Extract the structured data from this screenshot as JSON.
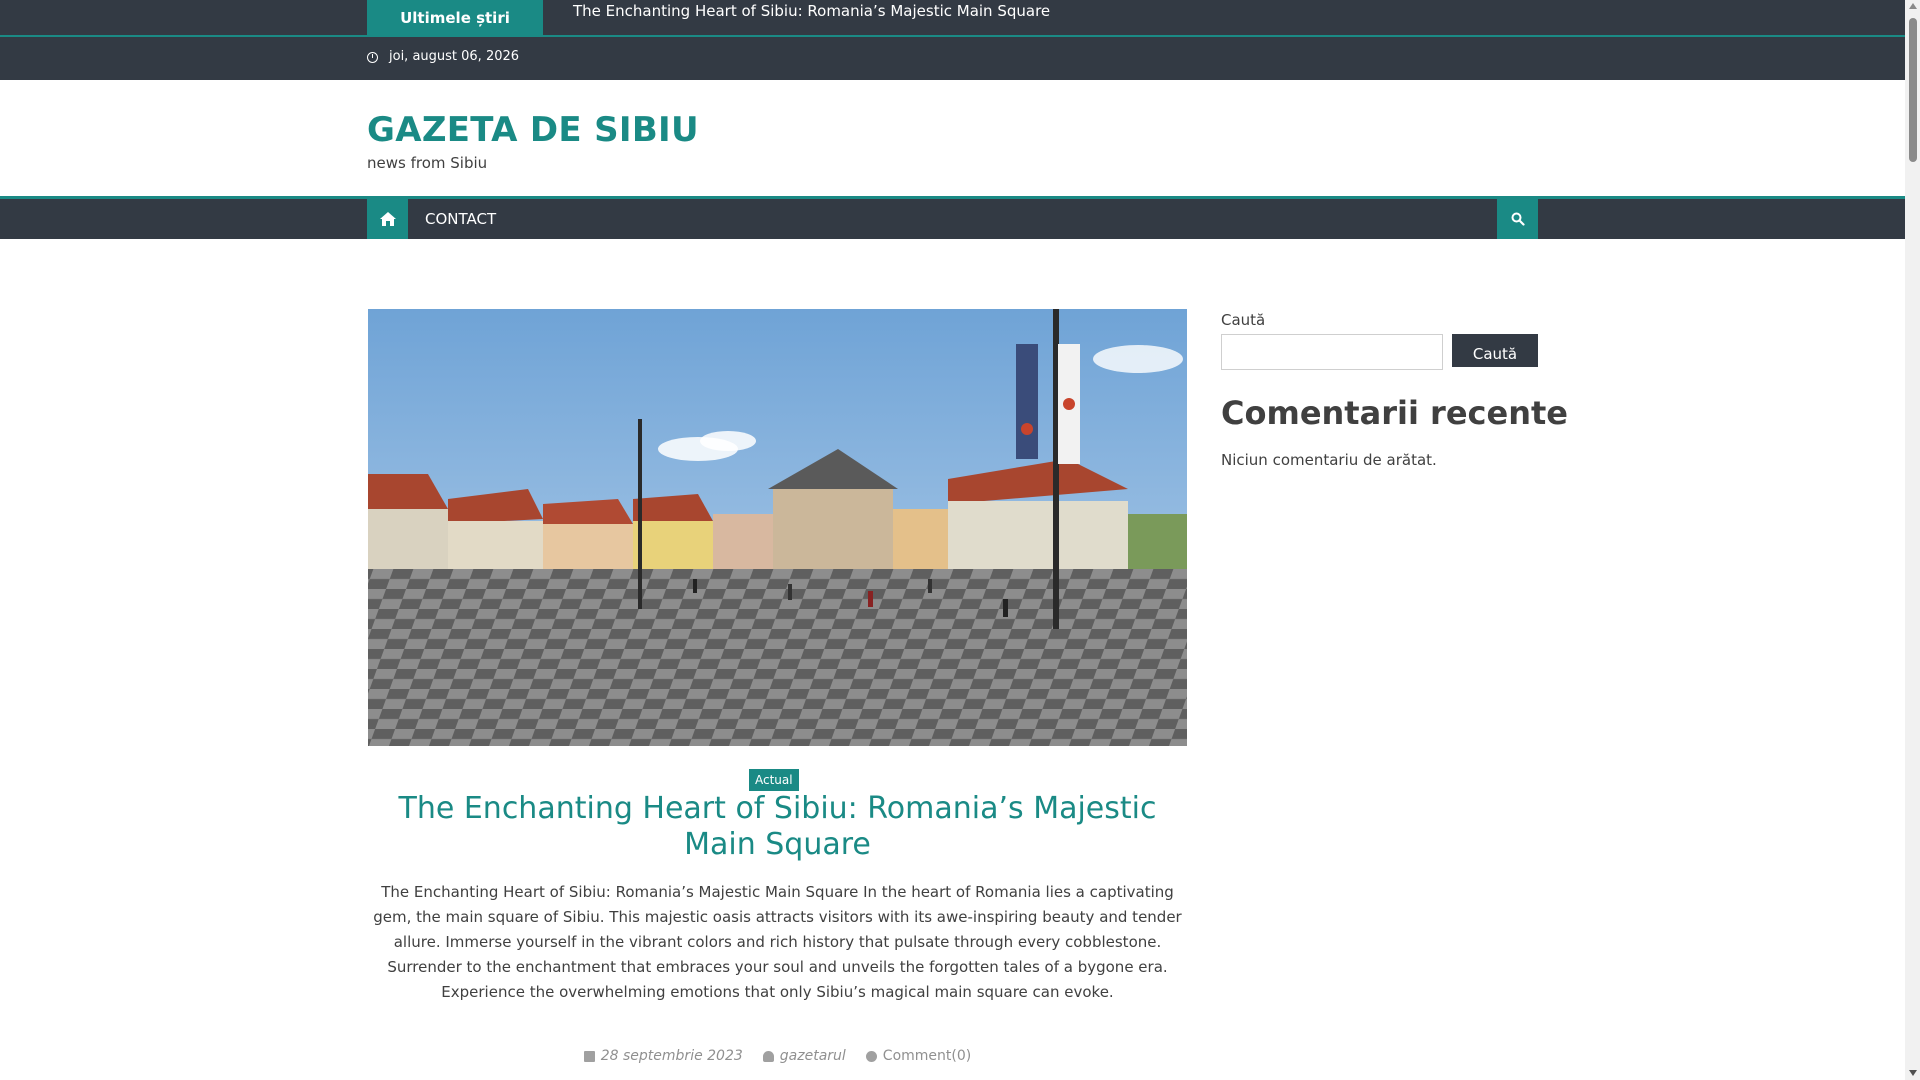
{
  "ticker": {
    "label": "Ultimele știri",
    "headline": "The Enchanting Heart of Sibiu: Romania’s Majestic Main Square"
  },
  "datebar": {
    "date": "joi, august 06, 2026",
    "icon": "clock-icon"
  },
  "site": {
    "title": "GAZETA DE SIBIU",
    "tagline": "news from Sibiu"
  },
  "nav": {
    "home_icon": "home-icon",
    "items": [
      {
        "label": "CONTACT"
      }
    ],
    "search_icon": "search-icon"
  },
  "post": {
    "image_alt": "Sibiu main square with colorful buildings and flags",
    "category": "Actual",
    "title": "The Enchanting Heart of Sibiu: Romania’s Majestic Main Square",
    "excerpt": "The Enchanting Heart of Sibiu: Romania’s Majestic Main Square In the heart of Romania lies a captivating gem, the main square of Sibiu. This majestic oasis attracts visitors with its awe-inspiring beauty and tender allure. Immerse yourself in the vibrant colors and rich history that pulsate through every cobblestone. Surrender to the enchantment that embraces your soul and unveils the forgotten tales of a bygone era. Experience the overwhelming emotions that only Sibiu’s magical main square can evoke.",
    "date": "28 septembrie 2023",
    "author": "gazetarul",
    "comments": "Comment(0)"
  },
  "sidebar": {
    "search_label": "Caută",
    "search_button": "Caută",
    "recent_comments_heading": "Comentarii recente",
    "recent_comments_empty": "Niciun comentariu de arătat."
  },
  "colors": {
    "accent": "#1a8a85",
    "dark_bar": "#333a44"
  }
}
